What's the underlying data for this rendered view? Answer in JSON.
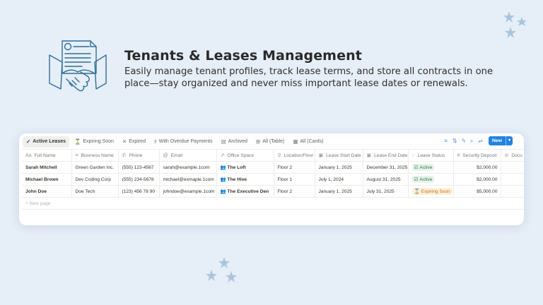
{
  "hero": {
    "title": "Tenants & Leases Management",
    "subtitle": "Easily manage tenant profiles, track lease terms, and store all contracts in one place—stay organized and never miss important lease dates or renewals.",
    "illustration_icon": "contract-handshake-icon"
  },
  "colors": {
    "background": "#e6eef7",
    "accent": "#2383e2",
    "illustration": "#2f6f99",
    "stars": "#a9c5dc"
  },
  "toolbar": {
    "tabs": [
      {
        "label": "Active Leases",
        "icon": "check-icon",
        "active": true
      },
      {
        "label": "Expiring Soon",
        "icon": "hourglass-icon"
      },
      {
        "label": "Expired",
        "icon": "x-icon"
      },
      {
        "label": "With Overdue Payments",
        "icon": "exclamation-icon"
      },
      {
        "label": "Archived",
        "icon": "archive-icon"
      },
      {
        "label": "All (Table)",
        "icon": "table-icon"
      },
      {
        "label": "All (Cards)",
        "icon": "gallery-icon"
      }
    ],
    "tools": [
      "filter-icon",
      "sort-icon",
      "lightning-icon",
      "search-icon",
      "settings-icon"
    ],
    "new_label": "New"
  },
  "table": {
    "columns": [
      "Full Name",
      "Business Name",
      "Phone",
      "Email",
      "Office Space",
      "Location/Floor",
      "Lease Start Date",
      "Lease End Date",
      "Lease Status",
      "Security Deposit",
      "Docu"
    ],
    "rows": [
      [
        "Sarah Mitchell",
        "Green Garden Inc.",
        "(555) 123-4567",
        "sarah@example.1com",
        "The Loft",
        "Floor 2",
        "January 1, 2025",
        "December 31, 2025",
        "Active",
        "$2,000.00",
        ""
      ],
      [
        "Michael Brown",
        "Dev Coding Corp",
        "(555) 234-5678",
        "michael@exmaple.1com",
        "The Hive",
        "Floor 1",
        "July 1, 2024",
        "August 31, 2025",
        "Active",
        "$2,000.00",
        ""
      ],
      [
        "John Doe",
        "Doe Tech",
        "(123) 456 78 90",
        "johndoe@example.1com",
        "The Executive Den",
        "Floor 2",
        "January 1, 2025",
        "July 31, 2025",
        "Expiring Soon",
        "$5,000.00",
        ""
      ]
    ],
    "new_row_label": "New page"
  }
}
